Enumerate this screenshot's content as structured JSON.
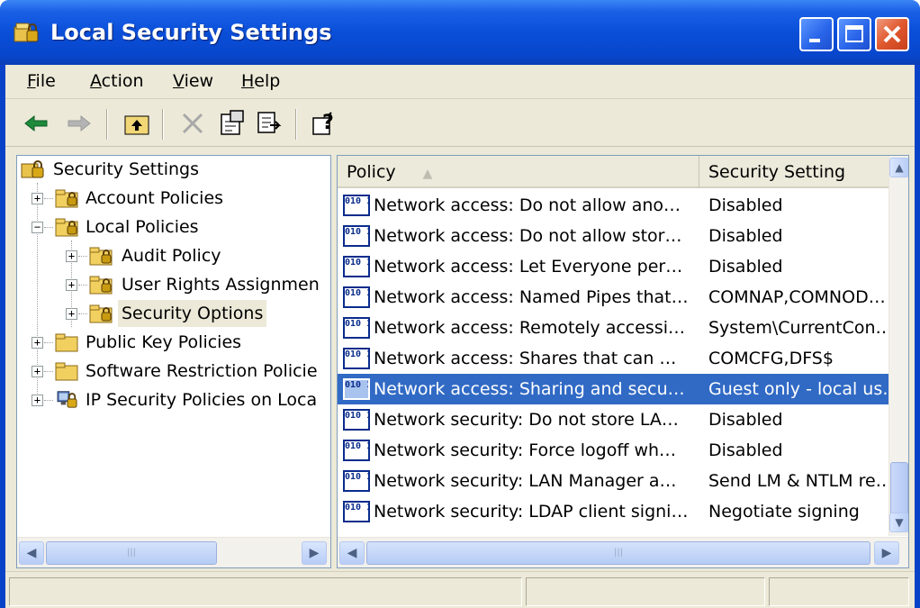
{
  "window": {
    "title": "Local Security Settings"
  },
  "menu": [
    {
      "label": "File",
      "u": "F",
      "rest": "ile"
    },
    {
      "label": "Action",
      "u": "A",
      "rest": "ction"
    },
    {
      "label": "View",
      "u": "V",
      "rest": "iew"
    },
    {
      "label": "Help",
      "u": "H",
      "rest": "elp"
    }
  ],
  "toolbar": [
    "back-icon",
    "forward-icon",
    "up-folder-icon",
    "delete-icon",
    "properties-icon",
    "export-list-icon",
    "help-icon"
  ],
  "tree": {
    "root": "Security Settings",
    "items": [
      {
        "label": "Account Policies",
        "expander": "+"
      },
      {
        "label": "Local Policies",
        "expander": "−"
      },
      {
        "label": "Audit Policy",
        "expander": "+"
      },
      {
        "label": "User Rights Assignmen",
        "expander": "+"
      },
      {
        "label": "Security Options",
        "expander": "+"
      },
      {
        "label": "Public Key Policies",
        "expander": "+"
      },
      {
        "label": "Software Restriction Policie",
        "expander": "+"
      },
      {
        "label": "IP Security Policies on Loca",
        "expander": "+"
      }
    ]
  },
  "list": {
    "columns": {
      "policy": "Policy",
      "setting": "Security Setting"
    },
    "rows": [
      {
        "policy": "Network access: Do not allow ano…",
        "setting": "Disabled"
      },
      {
        "policy": "Network access: Do not allow stor…",
        "setting": "Disabled"
      },
      {
        "policy": "Network access: Let Everyone per…",
        "setting": "Disabled"
      },
      {
        "policy": "Network access: Named Pipes that…",
        "setting": "COMNAP,COMNOD…"
      },
      {
        "policy": "Network access: Remotely accessi…",
        "setting": "System\\CurrentCon…"
      },
      {
        "policy": "Network access: Shares that can …",
        "setting": "COMCFG,DFS$"
      },
      {
        "policy": "Network access: Sharing and secu…",
        "setting": "Guest only - local us…"
      },
      {
        "policy": "Network security: Do not store LA…",
        "setting": "Disabled"
      },
      {
        "policy": "Network security: Force logoff wh…",
        "setting": "Disabled"
      },
      {
        "policy": "Network security: LAN Manager a…",
        "setting": "Send LM & NTLM re…"
      },
      {
        "policy": "Network security: LDAP client signi…",
        "setting": "Negotiate signing"
      }
    ],
    "selected_index": 6
  },
  "colors": {
    "titlebar": "#0a4fd8",
    "selection": "#316ac5",
    "face": "#ece9d8"
  }
}
